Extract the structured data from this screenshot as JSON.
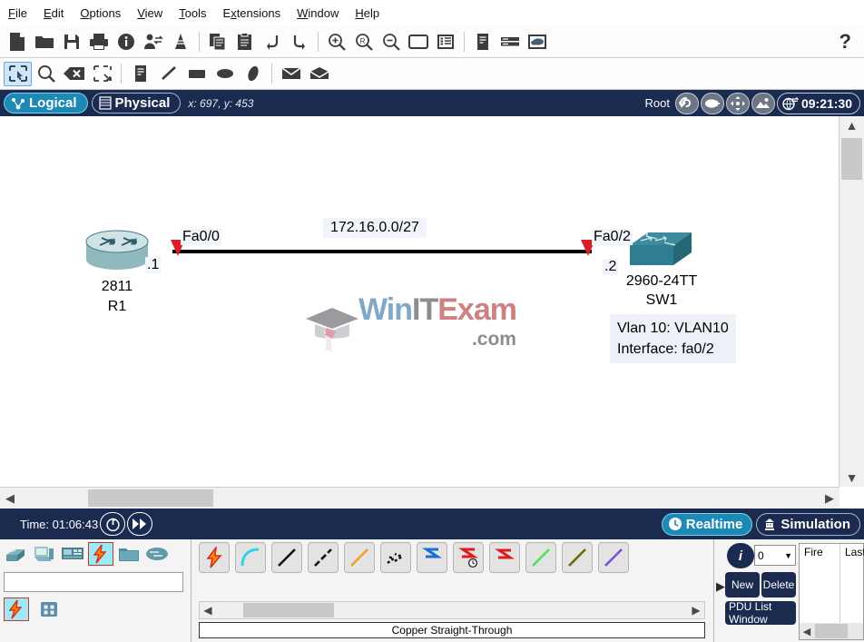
{
  "menu": {
    "items": [
      {
        "label": "File",
        "accel": "F"
      },
      {
        "label": "Edit",
        "accel": "E"
      },
      {
        "label": "Options",
        "accel": "O"
      },
      {
        "label": "View",
        "accel": "V"
      },
      {
        "label": "Tools",
        "accel": "T"
      },
      {
        "label": "Extensions",
        "accel": "x"
      },
      {
        "label": "Window",
        "accel": "W"
      },
      {
        "label": "Help",
        "accel": "H"
      }
    ]
  },
  "toolbar_main": {
    "help_label": "?",
    "buttons": [
      {
        "name": "new-file-icon",
        "title": "New"
      },
      {
        "name": "open-folder-icon",
        "title": "Open"
      },
      {
        "name": "save-icon",
        "title": "Save"
      },
      {
        "name": "print-icon",
        "title": "Print"
      },
      {
        "name": "activity-wizard-icon",
        "title": "Activity Wizard"
      },
      {
        "name": "network-info-icon",
        "title": "Network Information"
      },
      {
        "name": "multiuser-icon",
        "title": "Multiuser"
      },
      {
        "name": "copy-icon",
        "title": "Copy"
      },
      {
        "name": "paste-icon",
        "title": "Paste"
      },
      {
        "name": "undo-icon",
        "title": "Undo"
      },
      {
        "name": "redo-icon",
        "title": "Redo"
      },
      {
        "name": "zoom-in-icon",
        "title": "Zoom In"
      },
      {
        "name": "zoom-reset-icon",
        "title": "Zoom Reset"
      },
      {
        "name": "zoom-out-icon",
        "title": "Zoom Out"
      },
      {
        "name": "palette-window-icon",
        "title": "Palette"
      },
      {
        "name": "custom-devices-icon",
        "title": "Custom Devices Dialog"
      },
      {
        "name": "device-list-icon",
        "title": "Device List"
      },
      {
        "name": "rack-view-icon",
        "title": "Rack View"
      },
      {
        "name": "cloud-view-icon",
        "title": "Cloud View"
      }
    ]
  },
  "toolbar_tools": {
    "buttons": [
      {
        "name": "select-tool-icon",
        "title": "Select",
        "selected": true
      },
      {
        "name": "inspect-tool-icon",
        "title": "Inspect",
        "selected": false
      },
      {
        "name": "delete-tool-icon",
        "title": "Delete",
        "selected": false
      },
      {
        "name": "resize-shape-tool-icon",
        "title": "Resize Shape",
        "selected": false
      },
      {
        "name": "place-note-tool-icon",
        "title": "Place Note",
        "selected": false
      },
      {
        "name": "draw-line-tool-icon",
        "title": "Draw Line",
        "selected": false
      },
      {
        "name": "draw-rectangle-tool-icon",
        "title": "Draw Rectangle",
        "selected": false
      },
      {
        "name": "draw-ellipse-tool-icon",
        "title": "Draw Ellipse",
        "selected": false
      },
      {
        "name": "draw-freeform-tool-icon",
        "title": "Draw Freeform",
        "selected": false
      },
      {
        "name": "simple-pdu-tool-icon",
        "title": "Add Simple PDU",
        "selected": false
      },
      {
        "name": "complex-pdu-tool-icon",
        "title": "Add Complex PDU",
        "selected": false
      }
    ]
  },
  "viewbar": {
    "logical_tab": "Logical",
    "physical_tab": "Physical",
    "active_tab": "Logical",
    "coords": "x: 697, y: 453",
    "root_label": "Root",
    "clock": "09:21:30",
    "buttons": [
      {
        "name": "navigate-back-icon",
        "title": "Back"
      },
      {
        "name": "new-cluster-icon",
        "title": "New Cluster"
      },
      {
        "name": "move-object-icon",
        "title": "Move Object"
      },
      {
        "name": "set-tiled-background-icon",
        "title": "Set Tiled Background"
      },
      {
        "name": "viewport-icon",
        "title": "Viewport"
      }
    ]
  },
  "topology": {
    "network_label": "172.16.0.0/27",
    "router": {
      "model": "2811",
      "hostname": "R1",
      "interface": "Fa0/0",
      "address_suffix": ".1"
    },
    "switch": {
      "model": "2960-24TT",
      "hostname": "SW1",
      "interface": "Fa0/2",
      "address_suffix": ".2",
      "note_line1": "Vlan 10: VLAN10",
      "note_line2": "Interface: fa0/2"
    }
  },
  "watermark": {
    "part_win": "Win",
    "part_it": "IT",
    "part_exam": "Exam",
    "part_com": ".com",
    "color_win": "#7fa8c9",
    "color_it": "#8d8d8d",
    "color_exam": "#cf8080"
  },
  "playbar": {
    "time_label": "Time: 01:06:43",
    "realtime_label": "Realtime",
    "simulation_label": "Simulation",
    "active_mode": "Realtime",
    "buttons": [
      {
        "name": "power-cycle-devices-icon",
        "title": "Power Cycle Devices"
      },
      {
        "name": "fast-forward-time-icon",
        "title": "Fast Forward Time"
      }
    ]
  },
  "device_palette": {
    "search_value": "",
    "search_placeholder": "",
    "categories": [
      {
        "name": "network-devices-icon",
        "title": "Network Devices",
        "selected": false
      },
      {
        "name": "end-devices-icon",
        "title": "End Devices",
        "selected": false
      },
      {
        "name": "components-icon",
        "title": "Components",
        "selected": false
      },
      {
        "name": "connections-icon",
        "title": "Connections",
        "selected": true
      },
      {
        "name": "miscellaneous-icon",
        "title": "Miscellaneous",
        "selected": false
      },
      {
        "name": "multiuser-connection-icon",
        "title": "Multiuser Connection",
        "selected": false
      }
    ],
    "subcategories": [
      {
        "name": "connections-sub-icon",
        "title": "Connections",
        "selected": true
      },
      {
        "name": "all-devices-sub-icon",
        "title": "All Devices",
        "selected": false
      }
    ]
  },
  "cable_panel": {
    "caption": "Copper Straight-Through",
    "cables": [
      {
        "name": "automatic-cable-icon",
        "title": "Automatically Choose Connection Type"
      },
      {
        "name": "console-cable-icon",
        "title": "Console"
      },
      {
        "name": "copper-straight-cable-icon",
        "title": "Copper Straight-Through"
      },
      {
        "name": "copper-crossover-cable-icon",
        "title": "Copper Cross-Over"
      },
      {
        "name": "fiber-cable-icon",
        "title": "Fiber"
      },
      {
        "name": "phone-cable-icon",
        "title": "Phone"
      },
      {
        "name": "coaxial-cable-icon",
        "title": "Coaxial"
      },
      {
        "name": "serial-dce-cable-icon",
        "title": "Serial DCE"
      },
      {
        "name": "serial-dte-cable-icon",
        "title": "Serial DTE"
      },
      {
        "name": "octal-cable-icon",
        "title": "Octal"
      },
      {
        "name": "iot-custom-cable-icon",
        "title": "IoT Custom Cable"
      },
      {
        "name": "usb-cable-icon",
        "title": "USB"
      }
    ]
  },
  "pdu_panel": {
    "scenario_value": "0",
    "new_label": "New",
    "delete_label": "Delete",
    "pdu_list_label": "PDU List Window",
    "info_glyph": "i",
    "columns": [
      "Fire",
      "Last Status"
    ]
  }
}
